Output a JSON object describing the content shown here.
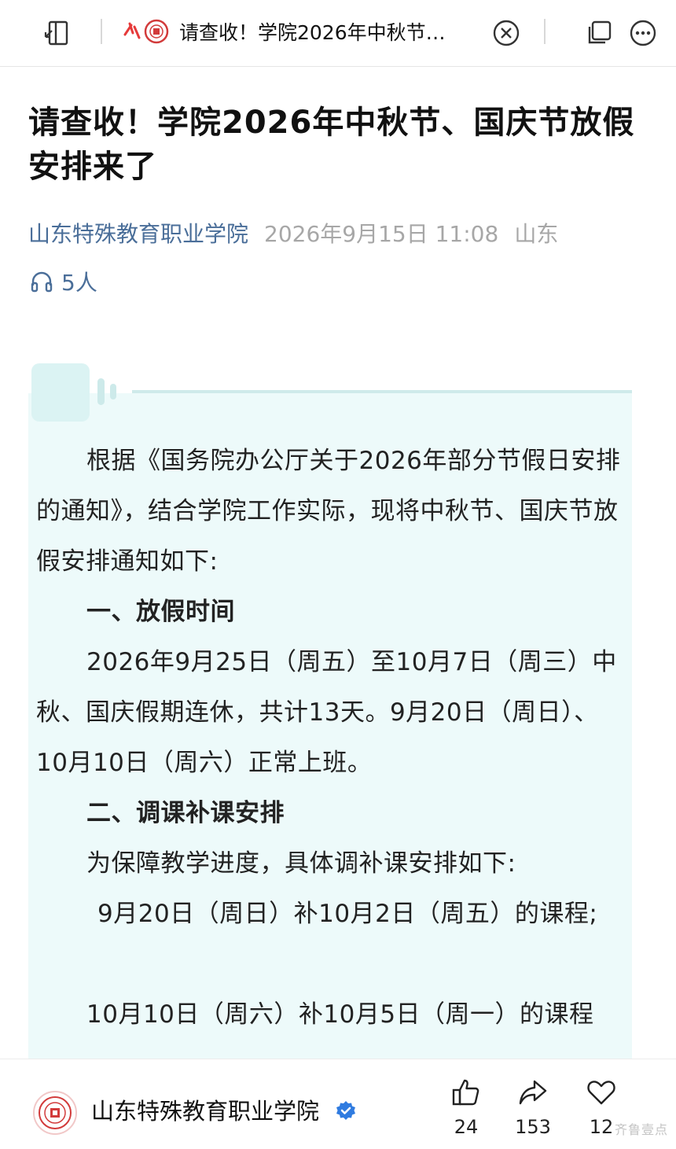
{
  "topbar": {
    "tab_title": "请查收！学院2026年中秋节…",
    "icons": [
      "split-screen-icon",
      "college-logo-icon",
      "close-icon",
      "copy-window-icon",
      "more-icon"
    ]
  },
  "article": {
    "title": "请查收！学院2026年中秋节、国庆节放假安排来了",
    "author": "山东特殊教育职业学院",
    "datetime": "2026年9月15日 11:08",
    "location": "山东",
    "listeners": "5人",
    "paragraphs": {
      "intro": "根据《国务院办公厅关于2026年部分节假日安排的通知》，结合学院工作实际，现将中秋节、国庆节放假安排通知如下:",
      "h1": "一、放假时间",
      "p1": "2026年9月25日（周五）至10月7日（周三）中秋、国庆假期连休，共计13天。9月20日（周日）、10月10日（周六）正常上班。",
      "h2": "二、调课补课安排",
      "p2": "为保障教学进度，具体调补课安排如下:",
      "p3": "9月20日（周日）补10月2日（周五）的课程;",
      "p4": "10月10日（周六）补10月5日（周一）的课程"
    }
  },
  "bottombar": {
    "account_name": "山东特殊教育职业学院",
    "likes": "24",
    "shares": "153",
    "favorites": "12",
    "watermark": "齐鲁壹点"
  },
  "colors": {
    "author": "#4a6e99",
    "meta_grey": "#a7a7a7",
    "card_bg": "#edfafa",
    "verified": "#2f7be0"
  }
}
